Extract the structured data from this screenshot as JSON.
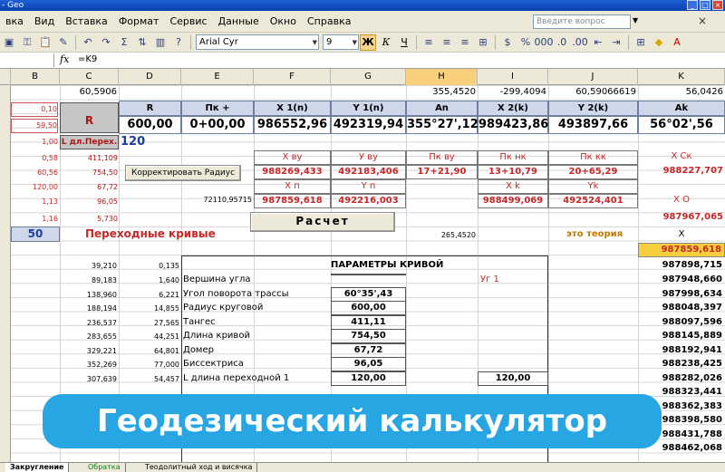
{
  "window": {
    "title": "- Geo"
  },
  "menu": {
    "items": [
      "вка",
      "Вид",
      "Вставка",
      "Формат",
      "Сервис",
      "Данные",
      "Окно",
      "Справка"
    ],
    "help_placeholder": "Введите вопрос"
  },
  "toolbar": {
    "font": "Arial Cyr",
    "size": "9"
  },
  "formula_bar": {
    "fx": "fx",
    "formula": "=K9"
  },
  "columns": [
    "B",
    "C",
    "D",
    "E",
    "F",
    "G",
    "H",
    "I",
    "J",
    "K"
  ],
  "top_values": {
    "c1": "60,5906",
    "h1": "355,4520",
    "i1": "-299,4094",
    "j1": "60,59066619",
    "k1": "56,0426"
  },
  "left_values": {
    "b2": "0,10",
    "b3": "59,50",
    "b4": "1,00",
    "b5": "0,58",
    "b6": "60,56",
    "b7": "120,00",
    "b8": "1,13",
    "b9": "1,16",
    "c5": "411,109",
    "c6": "754,50",
    "c7": "67,72",
    "c8": "96,05",
    "c9": "5,730",
    "c_r": "R",
    "c_l": "L дл.Перех."
  },
  "main_headers": [
    "R",
    "Пк +",
    "X 1(n)",
    "Y 1(n)",
    "An",
    "X 2(k)",
    "Y 2(k)",
    "Ak"
  ],
  "main_values": [
    "600,00",
    "0+00,00",
    "986552,96",
    "492319,94",
    "355°27',12",
    "989423,86",
    "493897,66",
    "56°02',56"
  ],
  "l_value": "120",
  "btn_correct": "Корректировать Радиус",
  "btn_calc": "Расчет",
  "block1": {
    "headers": [
      "X ву",
      "У ву",
      "Пк ву",
      "Пк нк",
      "Пк кк",
      "X Ск"
    ],
    "values": [
      "988269,433",
      "492183,406",
      "17+21,90",
      "13+10,79",
      "20+65,29",
      "988227,707"
    ]
  },
  "block2": {
    "left_value": "72110,95715",
    "headers": [
      "X п",
      "Y п",
      "X k",
      "Yk"
    ],
    "values": [
      "987859,618",
      "492216,003",
      "988499,069",
      "492524,401"
    ],
    "xo_label": "X O",
    "xo_value": "987967,065"
  },
  "section": {
    "b_value": "50",
    "title": "Переходные кривые",
    "h_value": "265,4520",
    "theory": "это теория",
    "x_label": "X",
    "highlight": "987859,618"
  },
  "params_title": "ПАРАМЕТРЫ КРИВОЙ",
  "params_ugl": "Уг 1",
  "params": [
    {
      "label": "Вершина угла",
      "value": ""
    },
    {
      "label": "Угол поворота трассы",
      "value": "60°35',43"
    },
    {
      "label": "Радиус круговой",
      "value": "600,00"
    },
    {
      "label": "Тангес",
      "value": "411,11"
    },
    {
      "label": "Длина кривой",
      "value": "754,50"
    },
    {
      "label": "Домер",
      "value": "67,72"
    },
    {
      "label": "Биссектриса",
      "value": "96,05"
    },
    {
      "label": "L длина переходной 1",
      "value": "120,00",
      "extra": "120,00"
    }
  ],
  "c_list": [
    "39,210",
    "89,183",
    "138,960",
    "188,194",
    "236,537",
    "283,655",
    "329,221",
    "352,269",
    "307,639"
  ],
  "d_list": [
    "0,135",
    "1,640",
    "6,221",
    "14,855",
    "27,565",
    "44,251",
    "64,801",
    "77,000",
    "54,457"
  ],
  "k_list": [
    "987898,715",
    "987948,660",
    "987998,634",
    "988048,397",
    "988097,596",
    "988145,889",
    "988192,941",
    "988238,425",
    "988282,026",
    "988323,441",
    "988362,383",
    "988398,580",
    "988431,788",
    "988462,068"
  ],
  "sheet_tabs": [
    "Закругление",
    "Обратка",
    "Теодолитный ход и висячка"
  ],
  "banner_text": "Геодезический калькулятор"
}
